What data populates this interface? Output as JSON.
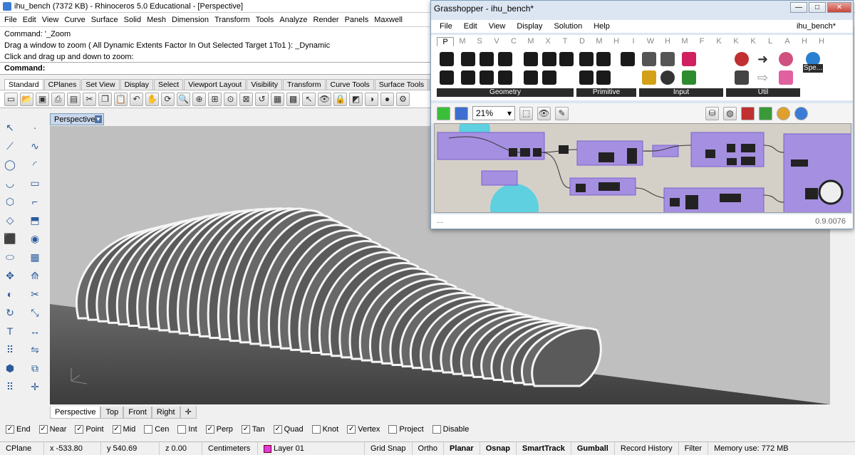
{
  "rhino": {
    "title": "ihu_bench (7372 KB) - Rhinoceros 5.0 Educational - [Perspective]",
    "menu": [
      "File",
      "Edit",
      "View",
      "Curve",
      "Surface",
      "Solid",
      "Mesh",
      "Dimension",
      "Transform",
      "Tools",
      "Analyze",
      "Render",
      "Panels",
      "Maxwell"
    ],
    "command_history": [
      "Command: '_Zoom",
      "Drag a window to zoom ( All  Dynamic  Extents  Factor  In  Out  Selected  Target  1To1 ): _Dynamic",
      "Click and drag up and down to zoom:"
    ],
    "command_prompt": "Command:",
    "toolbar_tabs": [
      "Standard",
      "CPlanes",
      "Set View",
      "Display",
      "Select",
      "Viewport Layout",
      "Visibility",
      "Transform",
      "Curve Tools",
      "Surface Tools",
      "So"
    ],
    "viewport_name": "Perspective",
    "viewport_tabs": [
      "Perspective",
      "Top",
      "Front",
      "Right"
    ],
    "osnap": [
      {
        "label": "End",
        "checked": true
      },
      {
        "label": "Near",
        "checked": true
      },
      {
        "label": "Point",
        "checked": true
      },
      {
        "label": "Mid",
        "checked": true
      },
      {
        "label": "Cen",
        "checked": false
      },
      {
        "label": "Int",
        "checked": false
      },
      {
        "label": "Perp",
        "checked": true
      },
      {
        "label": "Tan",
        "checked": true
      },
      {
        "label": "Quad",
        "checked": true
      },
      {
        "label": "Knot",
        "checked": false
      },
      {
        "label": "Vertex",
        "checked": true
      },
      {
        "label": "Project",
        "checked": false
      },
      {
        "label": "Disable",
        "checked": false
      }
    ],
    "status": {
      "cplane": "CPlane",
      "x": "x -533.80",
      "y": "y 540.69",
      "z": "z 0.00",
      "units": "Centimeters",
      "layer": "Layer 01",
      "grid_snap": "Grid Snap",
      "ortho": "Ortho",
      "planar": "Planar",
      "osnap": "Osnap",
      "smarttrack": "SmartTrack",
      "gumball": "Gumball",
      "record_history": "Record History",
      "filter": "Filter",
      "memory": "Memory use: 772 MB",
      "layer_color": "#e03be0"
    }
  },
  "grasshopper": {
    "title": "Grasshopper - ihu_bench*",
    "doc_name": "ihu_bench*",
    "menu": [
      "File",
      "Edit",
      "View",
      "Display",
      "Solution",
      "Help"
    ],
    "categories": [
      "P",
      "M",
      "S",
      "V",
      "C",
      "M",
      "X",
      "T",
      "D",
      "M",
      "H",
      "I",
      "W",
      "H",
      "M",
      "F",
      "K",
      "K",
      "K",
      "L",
      "A",
      "H",
      "H"
    ],
    "ribbon_groups": [
      "Geometry",
      "Primitive",
      "Input",
      "Util"
    ],
    "extra_label": "Spe...",
    "zoom": "21%",
    "version": "0.9.0076",
    "footer_dots": "...",
    "window_buttons": [
      "—",
      "□",
      "✕"
    ]
  },
  "colors": {
    "gh_group_purple": "#a58fe0",
    "gh_group_cyan": "#5ed0e0",
    "viewport_bg": "#bfbfbf"
  }
}
